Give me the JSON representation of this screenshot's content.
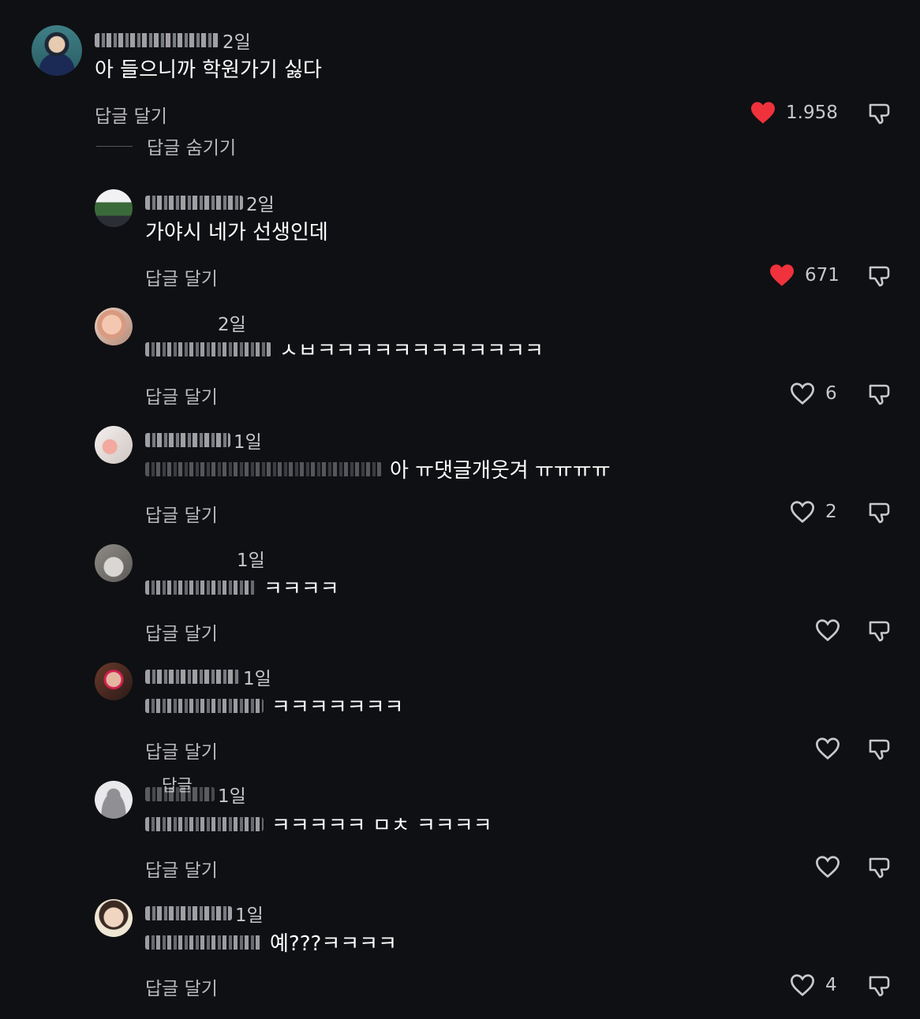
{
  "colors": {
    "background": "#0f1013",
    "liked_heart": "#f0323c",
    "muted_text": "#b9b9be"
  },
  "reply_label": "답글 달기",
  "hide_replies_label": "답글 숨기기",
  "floating_label": "답글",
  "icons": {
    "like": "heart-icon",
    "dislike": "thumb-down-icon"
  },
  "comments": [
    {
      "time": "2일",
      "text": "아 들으니까 학원가기 싫다",
      "likes": "1.958",
      "liked": true
    },
    {
      "time": "2일",
      "text": "가야시 네가 선생인데",
      "likes": "671",
      "liked": true
    },
    {
      "time": "2일",
      "text": "ㅅㅂㅋㅋㅋㅋㅋㅋㅋㅋㅋㅋㅋㅋ",
      "likes": "6",
      "liked": false
    },
    {
      "time": "1일",
      "text": "아 ㅠ댓글개웃겨 ㅠㅠㅠㅠ",
      "likes": "2",
      "liked": false
    },
    {
      "time": "1일",
      "text": "ㅋㅋㅋㅋ",
      "likes": "",
      "liked": false
    },
    {
      "time": "1일",
      "text": "ㅋㅋㅋㅋㅋㅋㅋ",
      "likes": "",
      "liked": false
    },
    {
      "time": "1일",
      "text": "ㅋㅋㅋㅋㅋ ㅁㅊ ㅋㅋㅋㅋ",
      "likes": "",
      "liked": false
    },
    {
      "time": "1일",
      "text": "예???ㅋㅋㅋㅋ",
      "likes": "4",
      "liked": false
    }
  ]
}
